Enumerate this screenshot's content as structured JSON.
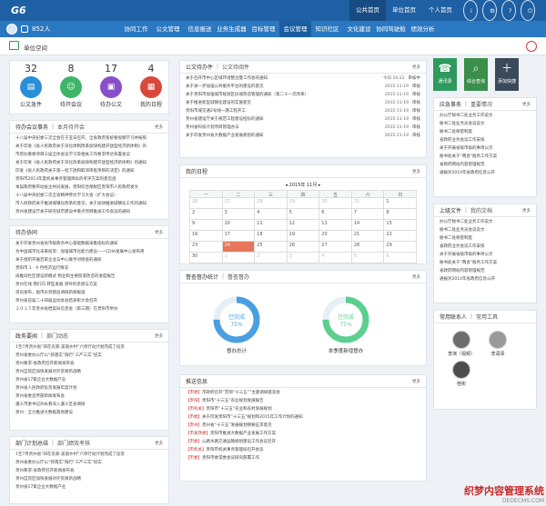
{
  "header": {
    "logo": "G6",
    "top_links": [
      "公共首页",
      "单位首页",
      "个人首页"
    ],
    "top_active": 0,
    "user_name": "852人",
    "menu": [
      "协同工作",
      "公文管理",
      "信息报送",
      "业务生成器",
      "目标管理",
      "会议管理",
      "知识社区",
      "文化建设",
      "协同驾驶舱",
      "绩效分析"
    ],
    "menu_active": 5
  },
  "breadcrumb": {
    "label": "单位空间"
  },
  "stats": [
    {
      "num": "32",
      "label": "公文急件",
      "color": "#2b8fd8",
      "icon": "document-icon"
    },
    {
      "num": "8",
      "label": "待开会议",
      "color": "#3fb56a",
      "icon": "people-icon"
    },
    {
      "num": "17",
      "label": "待办公文",
      "color": "#8a4fc8",
      "icon": "inbox-icon"
    },
    {
      "num": "4",
      "label": "我的日程",
      "color": "#d9483b",
      "icon": "calendar-icon"
    }
  ],
  "meeting_panel": {
    "tab1": "待办会议事务",
    "tab2": "本月待开会",
    "more": "更多",
    "items": [
      "十八届中央纪委三次全会在于丑日召开，全省政府系统要视察学习并按照",
      "关于印发《省人民政府关于深化体制改革加快构建开放型经济新体制》的",
      "市府办重要项目三届全体会议学习及相关工作要求传达布置会议",
      "关于印发《省人民政府关于深化改革加快构建开放型经济新体制》的通知",
      "印发《省人民政府关于第一批下放和取消审批项目的决定》的通知",
      "贵阳市2013年度机关事务管理目标的考评方案的意见函",
      "本届政府要带动省企共同发展，贵阳综合保税区贵阳市人民政府发文",
      "十八届中央纪委二次全会精神传达学习大会（扩大会议）",
      "市人民政府关于推进城镇化改革的意见，关于加快推进城镇化工作的通知",
      "贵州省建设厅关于研究城市建设中重点项目推进工作会议的通知"
    ]
  },
  "collab_panel": {
    "title": "待办协同",
    "more": "更多",
    "items": [
      "关于印发贵州省县市级政务中心基础数据采集指标的通知",
      "为中国城市化未来投资：加强城市化能力建设——CDIA发展中心发布简",
      "关于组织开展百家企业与中心联手对接会的通知",
      "贵阳市 1 - 9 月经济运行情况",
      "再推动社区建设新模式 物业和主要街道改造的进度报告",
      "贵州在线 我们向 转型发展 领导的思想与方案",
      "资讯发布，副市长到基层调研新闻报道",
      "贵州省首届二十四届运动会总结表彰大会召开",
      "２０１５年贵州省档案局信息会（第三期）在贵阳市举办"
    ]
  },
  "gov_panel": {
    "tab1": "政务要闻",
    "tab2": "部门动态",
    "more": "更多",
    "items": [
      "1至7月贵州省“四在农家·美丽乡村”六项行动计划完成了投资",
      "贵州省委办公厅以“抓落实”践行“三严三实”纪实",
      "贵州要求:省政府召开新闻发布会",
      "贵州自贸区加快发展对外贸易新战略",
      "贵州省17家企业大数据产业",
      "贵州省人民政府投资发展年度计划",
      "贵州省委宣传部新闻发布会",
      "遵义市委书记孙永春深入遵义区县调研",
      "贵州：全力推进大数据基地建设"
    ]
  },
  "dept_panel": {
    "tab1": "部门计划总结",
    "tab2": "部门绩效考核",
    "more": "更多",
    "items": [
      "1至7月贵州省“四在农家·美丽乡村”六项行动计划完成了投资",
      "贵州省委办公厅以“抓落实”践行“三严三实”纪实",
      "贵州要求:省政府召开新闻发布会",
      "贵州自贸区加快发展对外贸易新战略",
      "贵州省17家企业大数据产业"
    ]
  },
  "doc_panel": {
    "tab1": "公文待办件",
    "tab2": "公文待阅件",
    "more": "更多",
    "items": [
      {
        "title": "关于召开市中心区域环境整治暨工作会的通知",
        "date": "今日 10:22",
        "status": "审核中"
      },
      {
        "title": "关于进一步加强公共服务平台的建设的意见",
        "date": "2015-11-19",
        "status": "审核"
      },
      {
        "title": "关于贵阳市加强城市规划区旧城改造管理的通知（第二十一次改革）",
        "date": "2015-11-19",
        "status": "审核"
      },
      {
        "title": "关于推进新型城镇化建设的实施意见",
        "date": "2015-11-19",
        "status": "审核"
      },
      {
        "title": "贵阳市城交通2号线一期工程开工",
        "date": "2015-11-19",
        "status": "审核"
      },
      {
        "title": "贵州省建设厅关于规范工程建设招标的通知",
        "date": "2015-11-19",
        "status": "审核"
      },
      {
        "title": "贵州省科技计划项目管理办法",
        "date": "2015-11-19",
        "status": "审核"
      },
      {
        "title": "关于印发贵州省大数据产业发展规划的通知",
        "date": "2015-11-19",
        "status": "审核"
      }
    ]
  },
  "schedule_panel": {
    "title": "我的日程",
    "more": "更多",
    "month": "2015年 11月",
    "weekdays": [
      "一",
      "二",
      "三",
      "四",
      "五",
      "六",
      "日"
    ],
    "days": [
      [
        "26",
        "27",
        "28",
        "29",
        "30",
        "31",
        "1"
      ],
      [
        "2",
        "3",
        "4",
        "5",
        "6",
        "7",
        "8"
      ],
      [
        "9",
        "10",
        "11",
        "12",
        "13",
        "14",
        "15"
      ],
      [
        "16",
        "17",
        "18",
        "19",
        "20",
        "21",
        "22"
      ],
      [
        "23",
        "24",
        "25",
        "26",
        "27",
        "28",
        "29"
      ],
      [
        "30",
        "1",
        "2",
        "3",
        "4",
        "5",
        "6"
      ]
    ],
    "today": "24"
  },
  "supervise_panel": {
    "tab1": "督查督办统计",
    "tab2": "督查督办",
    "more": "更多",
    "charts": [
      {
        "status": "已完成",
        "percent": 75,
        "label": "督办总计",
        "color": "#4a9fe0"
      },
      {
        "status": "已完成",
        "percent": 75,
        "label": "本季度新增督办",
        "color": "#5ccf8f"
      }
    ]
  },
  "push_panel": {
    "title": "推送信息",
    "more": "更多",
    "items": [
      {
        "tag": "【市委】",
        "text": "市政府召开“贯彻“十三五””主题调研座谈会"
      },
      {
        "tag": "【贵阳】",
        "text": "贵阳市“十三五”农业规划发展报告"
      },
      {
        "tag": "【市机关】",
        "text": "贵阳市“十三五”农业和农村发展规划"
      },
      {
        "tag": "【市委】",
        "text": "关于印发贵阳市“十三五”规划和2015年工作计划的通知"
      },
      {
        "tag": "【贵州】",
        "text": "贵州省“十三五”发展规划纲要征求意见"
      },
      {
        "tag": "【市发改委】",
        "text": "贵阳市推进大数据产业发展工作方案"
      },
      {
        "tag": "【市委】",
        "text": "公路水路交通运输规划建设工作会议召开"
      },
      {
        "tag": "【市机关】",
        "text": "贵阳市机关事务管理局召开会议"
      },
      {
        "tag": "【市委】",
        "text": "贵阳市委常委会议研究部署工作"
      }
    ]
  },
  "quick_actions": [
    {
      "label": "通讯录",
      "color": "#2e9a5e",
      "icon": "phonebook-icon"
    },
    {
      "label": "综合查询",
      "color": "#3a8f4a",
      "icon": "search-icon"
    },
    {
      "label": "添加快捷",
      "color": "#3a4a5a",
      "icon": "plus-icon"
    }
  ],
  "emergency_panel": {
    "tab1": "应急事务",
    "tab2": "重要情况",
    "more": "更多",
    "items": [
      "办公厅秘书二处业务工作说文",
      "秘书二处业务员会议说文",
      "秘书二处保密制度",
      "省政府业务会议工作安排",
      "关于开展省级市级的事项公示",
      "秘书处关于“两会”服务工作方案",
      "省政府网站内容管理规范",
      "通报对2014年省政府信息公开"
    ]
  },
  "superior_panel": {
    "tab1": "上级文件",
    "tab2": "我的文档",
    "more": "更多",
    "items": [
      "办公厅秘书二处业务工作说文",
      "秘书二处业务员会议说文",
      "秘书二处保密制度",
      "省政府业务会议工作安排",
      "关于开展省级市级的事项公示",
      "秘书处关于“两会”服务工作方案",
      "省政府网站内容管理规范",
      "通报对2014年省政府信息公开"
    ]
  },
  "contacts_panel": {
    "tab1": "常用联系人",
    "tab2": "常用工具",
    "people": [
      {
        "name": "李演（视频）"
      },
      {
        "name": "李润泽"
      },
      {
        "name": "桂彬"
      }
    ]
  },
  "watermark": {
    "line1": "织梦内容管理系统",
    "line2": "DEDECMS.COM"
  }
}
